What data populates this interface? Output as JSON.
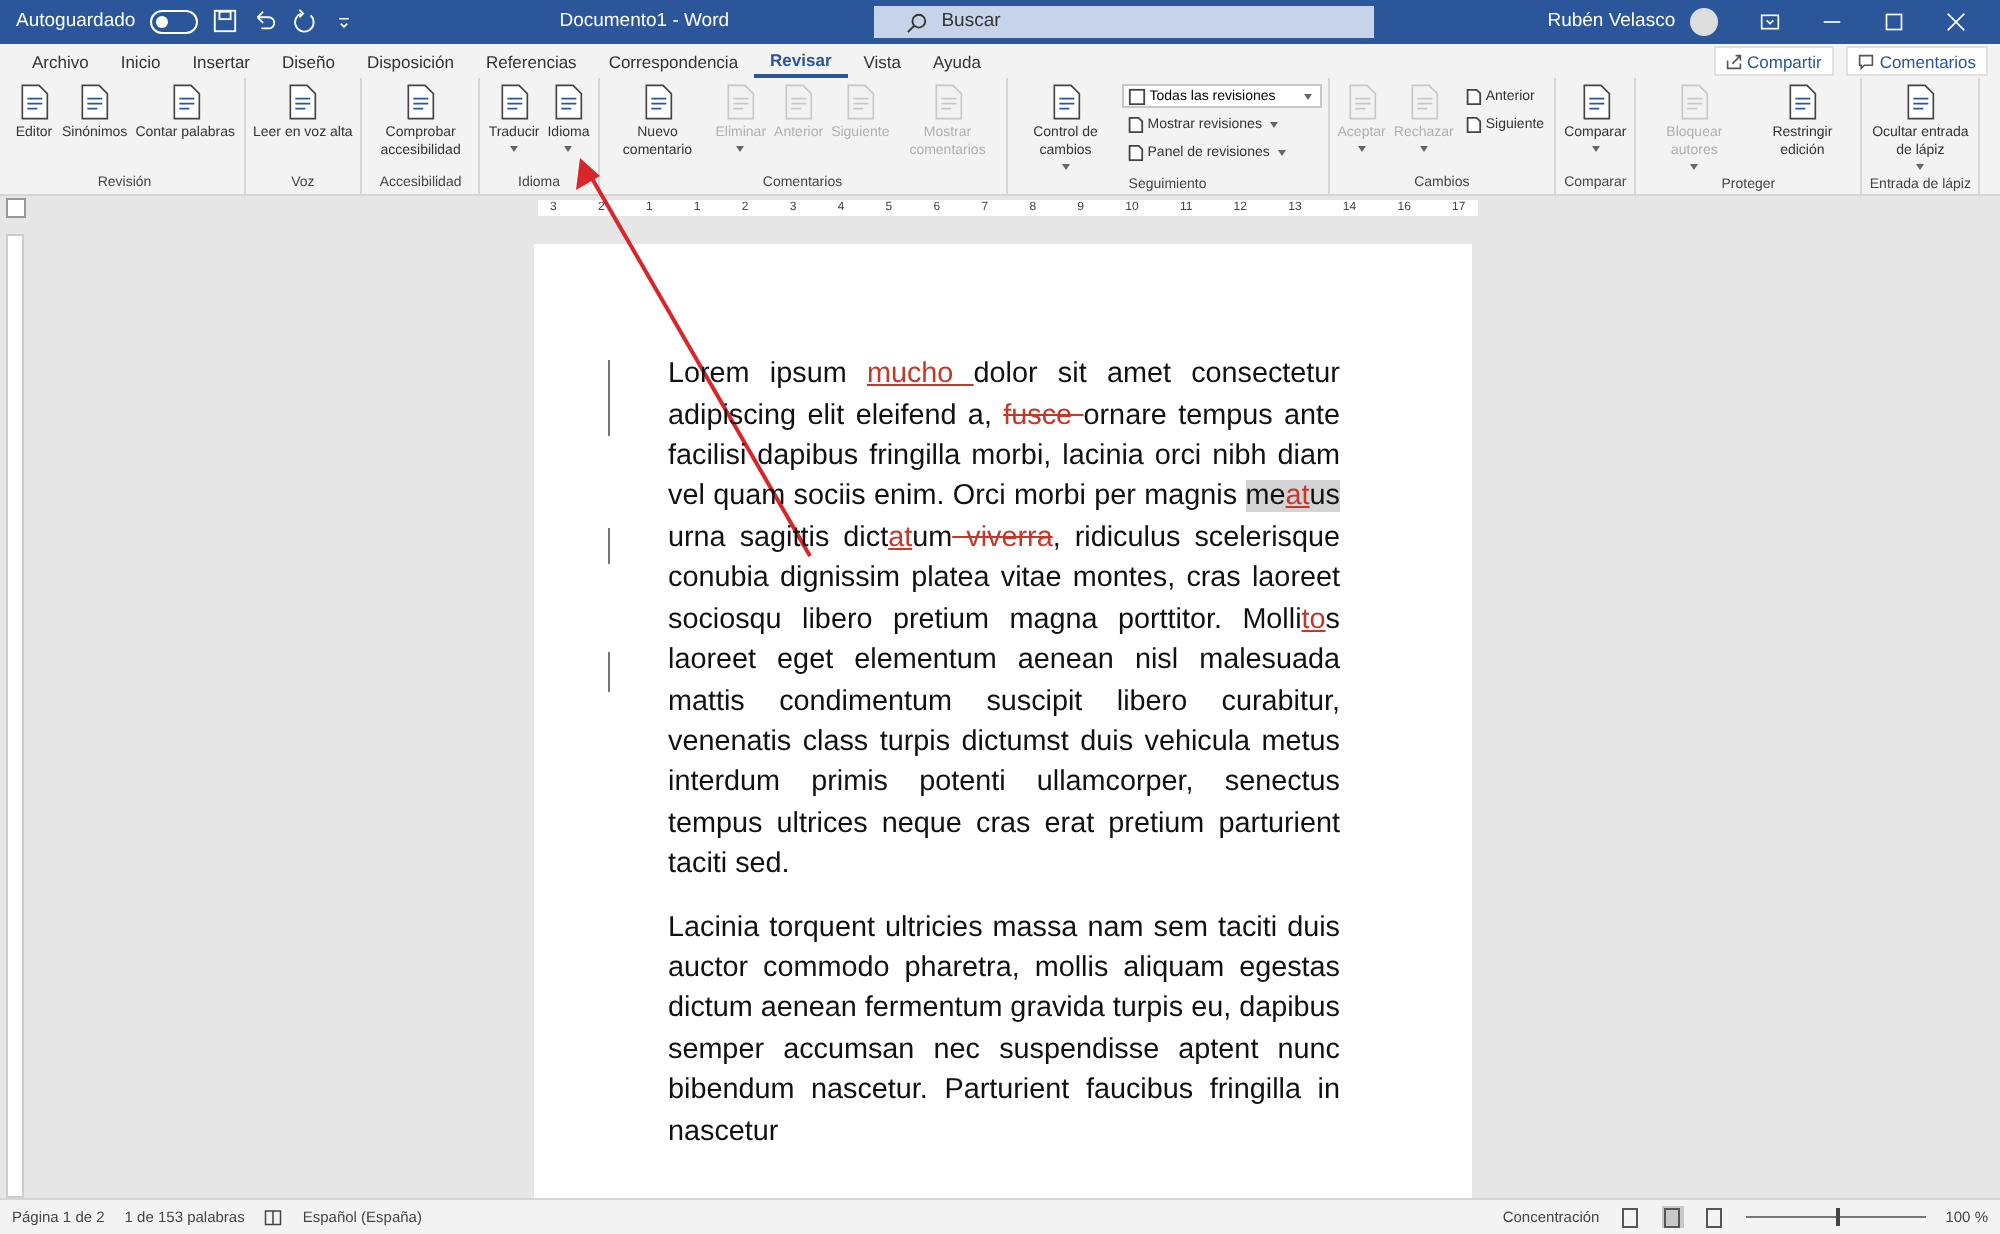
{
  "titlebar": {
    "autosave_label": "Autoguardado",
    "autosave_on": false,
    "title": "Documento1 - Word",
    "search": {
      "placeholder": "Buscar"
    },
    "user": "Rubén Velasco"
  },
  "tabs": [
    {
      "label": "Archivo",
      "selected": false
    },
    {
      "label": "Inicio",
      "selected": false
    },
    {
      "label": "Insertar",
      "selected": false
    },
    {
      "label": "Diseño",
      "selected": false
    },
    {
      "label": "Disposición",
      "selected": false
    },
    {
      "label": "Referencias",
      "selected": false
    },
    {
      "label": "Correspondencia",
      "selected": false
    },
    {
      "label": "Revisar",
      "selected": true
    },
    {
      "label": "Vista",
      "selected": false
    },
    {
      "label": "Ayuda",
      "selected": false
    }
  ],
  "share_button": "Compartir",
  "comments_button": "Comentarios",
  "ribbon_groups": [
    {
      "label": "Revisión",
      "items": [
        {
          "kind": "large",
          "label": "Editor",
          "disabled": false,
          "dropdown": false
        },
        {
          "kind": "large",
          "label": "Sinónimos",
          "disabled": false,
          "dropdown": false
        },
        {
          "kind": "large",
          "label": "Contar palabras",
          "disabled": false,
          "dropdown": false
        }
      ]
    },
    {
      "label": "Voz",
      "items": [
        {
          "kind": "large",
          "label": "Leer en voz alta",
          "disabled": false,
          "dropdown": false
        }
      ]
    },
    {
      "label": "Accesibilidad",
      "items": [
        {
          "kind": "large",
          "label": "Comprobar accesibilidad",
          "disabled": false,
          "dropdown": false
        }
      ]
    },
    {
      "label": "Idioma",
      "items": [
        {
          "kind": "large",
          "label": "Traducir",
          "disabled": false,
          "dropdown": true
        },
        {
          "kind": "large",
          "label": "Idioma",
          "disabled": false,
          "dropdown": true
        }
      ]
    },
    {
      "label": "Comentarios",
      "items": [
        {
          "kind": "large",
          "label": "Nuevo comentario",
          "disabled": false,
          "dropdown": false
        },
        {
          "kind": "large",
          "label": "Eliminar",
          "disabled": true,
          "dropdown": true
        },
        {
          "kind": "large",
          "label": "Anterior",
          "disabled": true,
          "dropdown": false
        },
        {
          "kind": "large",
          "label": "Siguiente",
          "disabled": true,
          "dropdown": false
        },
        {
          "kind": "large",
          "label": "Mostrar comentarios",
          "disabled": true,
          "dropdown": false
        }
      ]
    },
    {
      "label": "Seguimiento",
      "items": [
        {
          "kind": "large",
          "label": "Control de cambios",
          "disabled": false,
          "dropdown": true
        },
        {
          "kind": "select",
          "label": "Todas las revisiones",
          "disabled": false,
          "dropdown": true
        },
        {
          "kind": "small",
          "label": "Mostrar revisiones",
          "disabled": false,
          "dropdown": true
        },
        {
          "kind": "small",
          "label": "Panel de revisiones",
          "disabled": false,
          "dropdown": true
        }
      ]
    },
    {
      "label": "Cambios",
      "items": [
        {
          "kind": "large",
          "label": "Aceptar",
          "disabled": true,
          "dropdown": true
        },
        {
          "kind": "large",
          "label": "Rechazar",
          "disabled": true,
          "dropdown": true
        },
        {
          "kind": "small",
          "label": "Anterior",
          "disabled": false,
          "dropdown": false
        },
        {
          "kind": "small",
          "label": "Siguiente",
          "disabled": false,
          "dropdown": false
        }
      ]
    },
    {
      "label": "Comparar",
      "items": [
        {
          "kind": "large",
          "label": "Comparar",
          "disabled": false,
          "dropdown": true
        }
      ]
    },
    {
      "label": "Proteger",
      "items": [
        {
          "kind": "large",
          "label": "Bloquear autores",
          "disabled": true,
          "dropdown": true
        },
        {
          "kind": "large",
          "label": "Restringir edición",
          "disabled": false,
          "dropdown": false
        }
      ]
    },
    {
      "label": "Entrada de lápiz",
      "items": [
        {
          "kind": "large",
          "label": "Ocultar entrada de lápiz",
          "disabled": false,
          "dropdown": true
        }
      ]
    }
  ],
  "ruler": {
    "labels": [
      "3",
      "2",
      "1",
      "1",
      "2",
      "3",
      "4",
      "5",
      "6",
      "7",
      "8",
      "9",
      "10",
      "11",
      "12",
      "13",
      "14",
      "16",
      "17"
    ]
  },
  "document": {
    "paragraphs": [
      {
        "segments": [
          {
            "kind": "normal",
            "text": "Lorem ipsum "
          },
          {
            "kind": "insert",
            "text": "mucho "
          },
          {
            "kind": "normal",
            "text": "dolor sit amet consectetur adipiscing elit eleifend a, "
          },
          {
            "kind": "delete",
            "text": "fusce "
          },
          {
            "kind": "normal",
            "text": "ornare tempus ante facilisi dapibus fringilla morbi, lacinia orci nibh diam vel quam sociis enim. Orci morbi per magnis "
          },
          {
            "kind": "comment",
            "text": "me"
          },
          {
            "kind": "comment_insert",
            "text": "at"
          },
          {
            "kind": "comment",
            "text": "us"
          },
          {
            "kind": "normal",
            "text": " urna sagittis dict"
          },
          {
            "kind": "insert",
            "text": "at"
          },
          {
            "kind": "normal",
            "text": "um"
          },
          {
            "kind": "delete",
            "text": " viverra"
          },
          {
            "kind": "normal",
            "text": ", ridiculus scelerisque conubia dignissim platea vitae montes, cras laoreet sociosqu libero pretium magna porttitor. Molli"
          },
          {
            "kind": "insert",
            "text": "to"
          },
          {
            "kind": "normal",
            "text": "s laoreet eget elementum aenean nisl malesuada mattis condimentum suscipit libero curabitur, venenatis class turpis dictumst duis vehicula metus interdum primis potenti ullamcorper, senectus tempus ultrices neque cras erat pretium parturient taciti sed."
          }
        ]
      },
      {
        "segments": [
          {
            "kind": "normal",
            "text": "Lacinia torquent ultricies massa nam sem taciti duis auctor commodo pharetra, mollis aliquam egestas dictum aenean fermentum gravida turpis eu, dapibus semper accumsan nec suspendisse aptent nunc bibendum nascetur. Parturient faucibus fringilla in nascetur"
          }
        ]
      }
    ]
  },
  "status_bar": {
    "page": "Página 1 de 2",
    "words": "1 de 153 palabras",
    "language": "Español (España)",
    "focus": "Concentración",
    "views": [
      {
        "selected": false
      },
      {
        "selected": true
      },
      {
        "selected": false
      }
    ],
    "zoom": {
      "level": 0.5,
      "reading": "100 %"
    }
  }
}
